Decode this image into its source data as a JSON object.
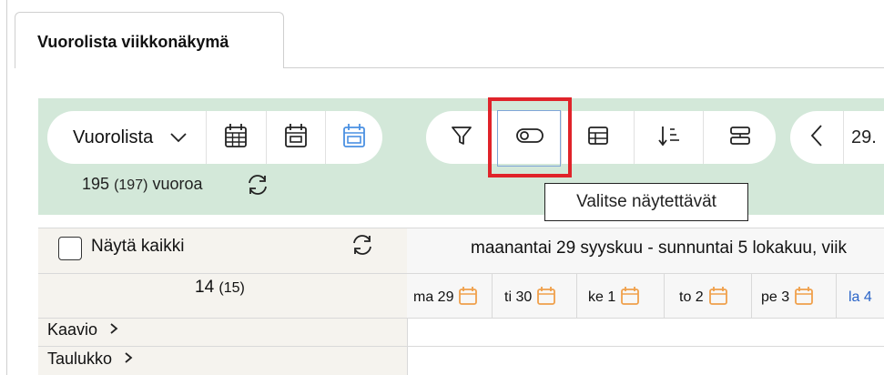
{
  "tab": {
    "label": "Vuorolista viikkonäkymä"
  },
  "toolbar": {
    "view_select": "Vuorolista",
    "date_text": "29.",
    "shift_count": "195",
    "shift_count_total": "(197)",
    "shift_count_suffix": "vuoroa",
    "tooltip": "Valitse näytettävät",
    "highlight_color": "#e0232a",
    "toolbar_bg": "#d3e8d9"
  },
  "grid": {
    "show_all_label": "Näytä kaikki",
    "employee_count": "14",
    "employee_count_total": "(15)",
    "week_title": "maanantai 29 syyskuu - sunnuntai 5 lokakuu, viik",
    "days": [
      {
        "label": "ma 29",
        "icon": "calendar-icon",
        "weekend": false
      },
      {
        "label": "ti 30",
        "icon": "calendar-icon",
        "weekend": false
      },
      {
        "label": "ke 1",
        "icon": "calendar-icon",
        "weekend": false
      },
      {
        "label": "to 2",
        "icon": "calendar-icon",
        "weekend": false
      },
      {
        "label": "pe 3",
        "icon": "calendar-icon",
        "weekend": false
      },
      {
        "label": "la 4",
        "icon": "",
        "weekend": true
      }
    ],
    "sections": [
      {
        "label": "Kaavio",
        "icon": "chevron-right-icon"
      },
      {
        "label": "Taulukko",
        "icon": "chevron-right-icon"
      }
    ]
  },
  "colors": {
    "calendar_icon": "#f0a04b",
    "weekend_text": "#2a64c8",
    "today_icon": "#4a90e2"
  }
}
